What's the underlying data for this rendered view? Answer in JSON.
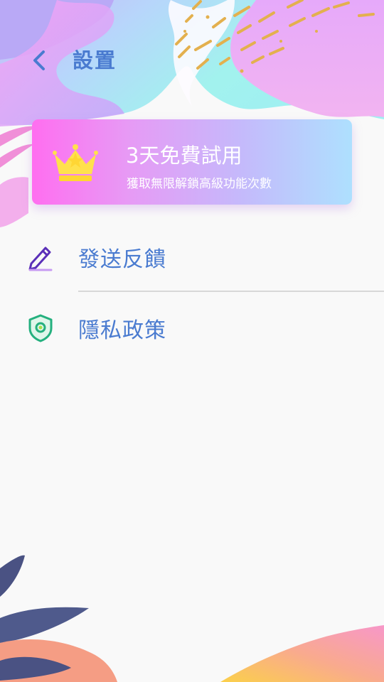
{
  "header": {
    "back_icon": "chevron-left-icon",
    "title": "設置"
  },
  "promo": {
    "icon": "crown-icon",
    "title": "3天免費試用",
    "subtitle": "獲取無限解鎖高級功能次數"
  },
  "menu": {
    "items": [
      {
        "icon": "pencil-icon",
        "label": "發送反饋"
      },
      {
        "icon": "shield-icon",
        "label": "隱私政策"
      }
    ]
  },
  "colors": {
    "accent": "#4a7bd0",
    "background": "#f9f9f9",
    "divider": "#d8d8d8"
  }
}
